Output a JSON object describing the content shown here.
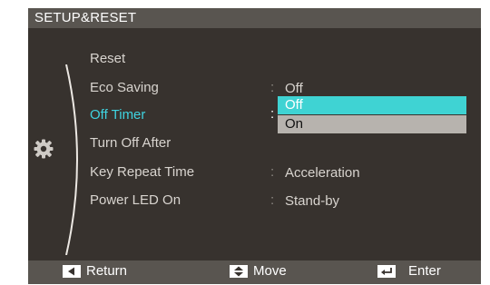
{
  "window": {
    "title": "SETUP&RESET"
  },
  "menu": {
    "items": [
      {
        "label": "Reset",
        "value": ""
      },
      {
        "label": "Eco Saving",
        "value": "Off"
      },
      {
        "label": "Off Timer",
        "value": ""
      },
      {
        "label": "Turn Off After",
        "value": ""
      },
      {
        "label": "Key Repeat Time",
        "value": "Acceleration"
      },
      {
        "label": "Power LED On",
        "value": "Stand-by"
      }
    ],
    "colon": ":",
    "selected_item": "Off Timer"
  },
  "dropdown": {
    "options": [
      "Off",
      "On"
    ],
    "selected": "Off"
  },
  "footer": {
    "return_label": "Return",
    "move_label": "Move",
    "enter_label": "Enter"
  },
  "colors": {
    "accent": "#3fd3e0",
    "highlight_bg": "#3fd3d3",
    "panel_bg": "#37322e",
    "bar_bg": "#595550"
  },
  "icons": {
    "category": "gear-icon",
    "return": "return-arrow-icon",
    "move": "up-down-arrows-icon",
    "enter": "enter-key-icon"
  }
}
